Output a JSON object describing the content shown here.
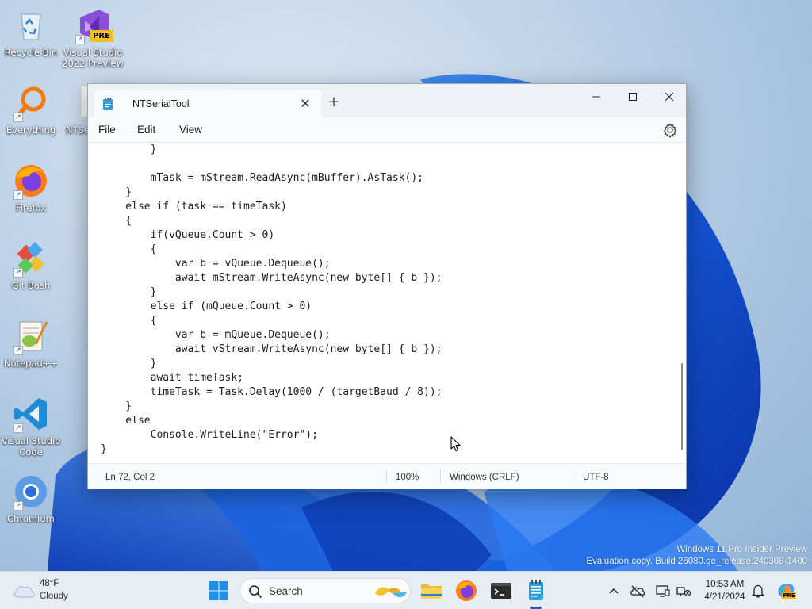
{
  "desktop": {
    "icons": [
      {
        "label": "Recycle Bin"
      },
      {
        "label": "Visual Studio 2022 Preview"
      },
      {
        "label": "Everything"
      },
      {
        "label": "NTSe"
      },
      {
        "label": "Firefox"
      },
      {
        "label": "Git Bash"
      },
      {
        "label": "Notepad++"
      },
      {
        "label": "Visual Studio Code"
      },
      {
        "label": "Chromium"
      }
    ],
    "vs_badge": "PRE"
  },
  "window": {
    "tab_title": "NTSerialTool",
    "new_tab_symbol": "+",
    "close_tab_symbol": "✕",
    "menus": {
      "file": "File",
      "edit": "Edit",
      "view": "View"
    },
    "code_lines": [
      "        }",
      "",
      "        mTask = mStream.ReadAsync(mBuffer).AsTask();",
      "    }",
      "    else if (task == timeTask)",
      "    {",
      "        if(vQueue.Count > 0)",
      "        {",
      "            var b = vQueue.Dequeue();",
      "            await mStream.WriteAsync(new byte[] { b });",
      "        }",
      "        else if (mQueue.Count > 0)",
      "        {",
      "            var b = mQueue.Dequeue();",
      "            await vStream.WriteAsync(new byte[] { b });",
      "        }",
      "        await timeTask;",
      "        timeTask = Task.Delay(1000 / (targetBaud / 8));",
      "    }",
      "    else",
      "        Console.WriteLine(\"Error\");",
      "}"
    ],
    "status": {
      "position": "Ln 72, Col 2",
      "zoom": "100%",
      "line_endings": "Windows (CRLF)",
      "encoding": "UTF-8"
    }
  },
  "watermark": {
    "line1": "Windows 11 Pro Insider Preview",
    "line2": "Evaluation copy. Build 26080.ge_release.240308-1400"
  },
  "taskbar": {
    "weather": {
      "temp": "48°F",
      "condition": "Cloudy"
    },
    "search_placeholder": "Search",
    "clock": {
      "time": "10:53 AM",
      "date": "4/21/2024"
    },
    "copilot_badge": "PRE"
  },
  "colors": {
    "accent": "#1a5fb4",
    "window_bg": "#ffffff",
    "taskbar_bg": "#e8edf3"
  }
}
